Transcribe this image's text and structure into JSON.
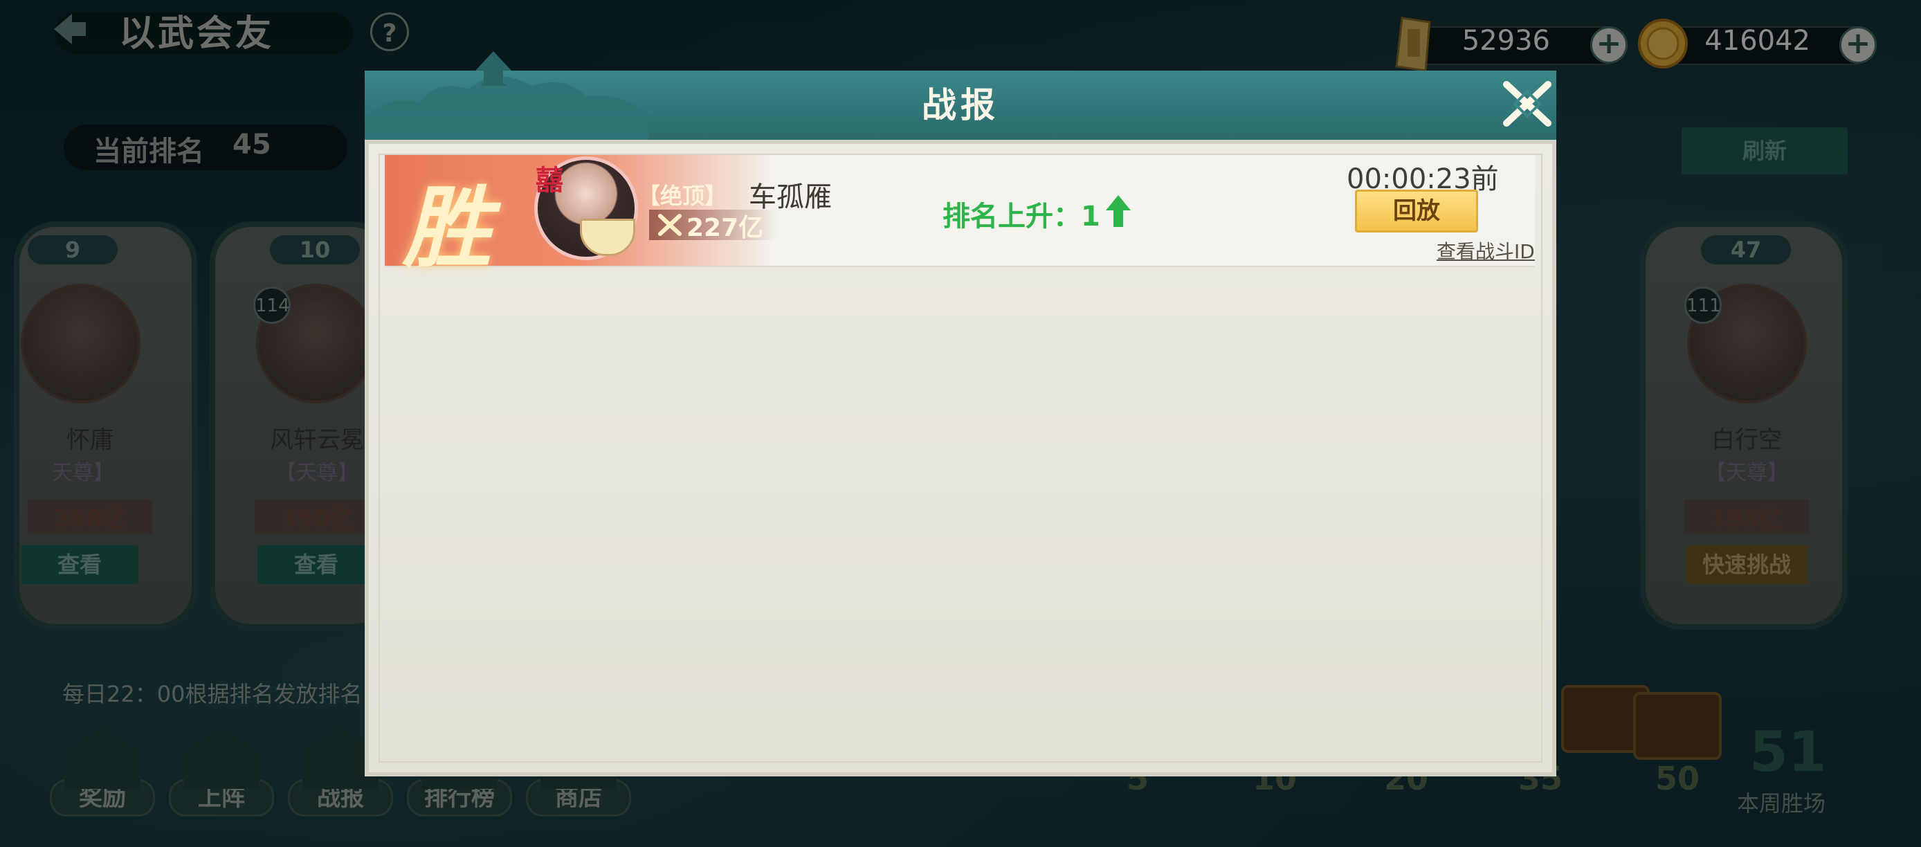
{
  "header": {
    "title": "以武会友",
    "help_glyph": "?"
  },
  "currency": {
    "ingot": {
      "value": "52936",
      "icon": "gold-ingot-icon",
      "plus": "+"
    },
    "coin": {
      "value": "416042",
      "icon": "gold-coin-icon",
      "plus": "+"
    }
  },
  "ranking": {
    "label": "当前排名",
    "value": "45",
    "refresh_label": "刷新"
  },
  "cards": [
    {
      "rank": "9",
      "level": "",
      "name": "怀庸",
      "title": "天尊】",
      "power": "358亿",
      "button": "查看"
    },
    {
      "rank": "10",
      "level": "114",
      "name": "风轩云冕",
      "title": "【天尊】",
      "power": "350亿",
      "button": "查看"
    },
    {
      "rank": "47",
      "level": "111",
      "name": "白行空",
      "title": "【天尊】",
      "power": "195亿",
      "button": "快速挑战"
    }
  ],
  "daily_note": "每日22：00根据排名发放排名",
  "nav": [
    {
      "label": "奖励",
      "icon": "reward-icon"
    },
    {
      "label": "上阵",
      "icon": "formation-icon"
    },
    {
      "label": "战报",
      "icon": "battle-report-icon"
    },
    {
      "label": "排行榜",
      "icon": "leaderboard-icon"
    },
    {
      "label": "商店",
      "icon": "shop-icon"
    }
  ],
  "progress": {
    "milestones": [
      "5",
      "10",
      "20",
      "35",
      "50"
    ],
    "week_wins": "51",
    "week_label": "本周胜场"
  },
  "dialog": {
    "title": "战报",
    "report": {
      "result": "胜",
      "opponent_badge": "囍",
      "opponent_rank_title": "【绝顶】",
      "opponent_power": "227亿",
      "opponent_name": "车孤雁",
      "rank_change": "排名上升：1",
      "time_ago": "00:00:23前",
      "replay_label": "回放",
      "battle_id_link": "查看战斗ID"
    }
  }
}
